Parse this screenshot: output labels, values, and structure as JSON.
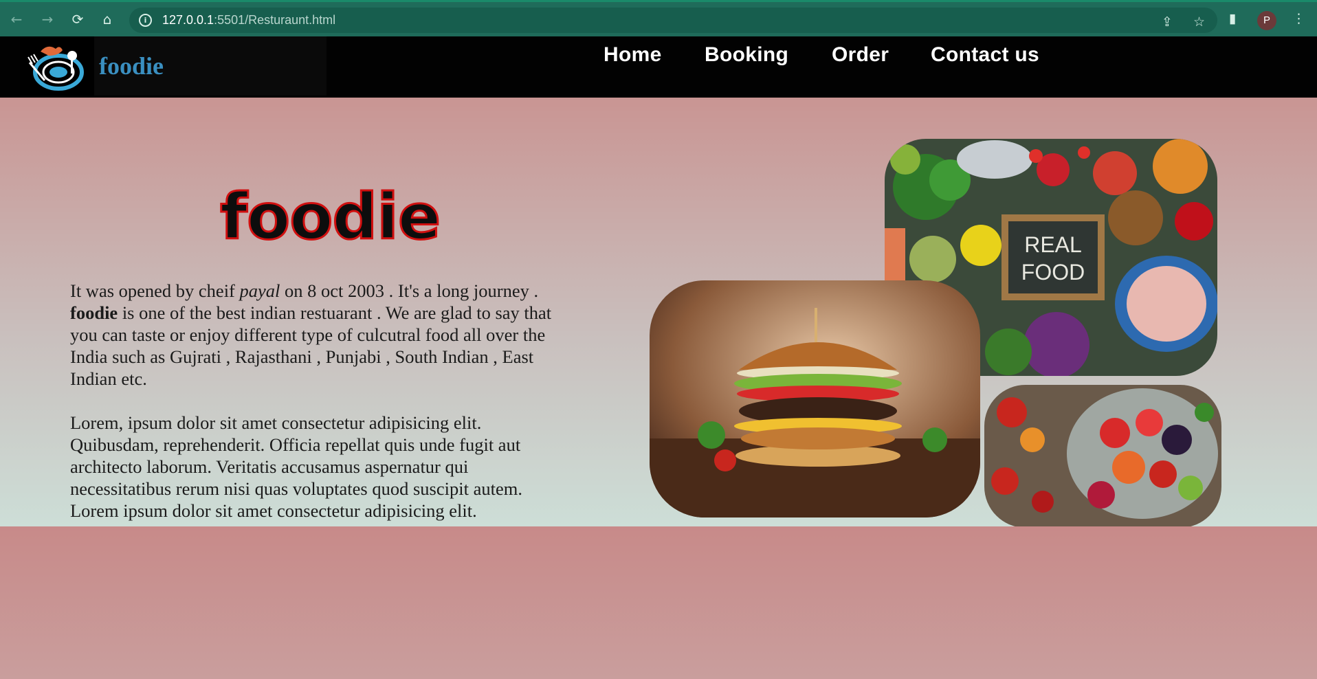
{
  "browser": {
    "url_host": "127.0.0.1",
    "url_path": ":5501/Resturaunt.html",
    "profile_initial": "P"
  },
  "site": {
    "logo_text": "foodie",
    "nav": [
      "Home",
      "Booking",
      "Order",
      "Contact us"
    ]
  },
  "hero": {
    "title": "foodie",
    "para1_a": "It was opened by cheif ",
    "para1_name": "payal",
    "para1_b": " on 8 oct 2003 . It's a long journey . ",
    "para1_brand": "foodie",
    "para1_c": " is one of the best indian restuarant . We are glad to say that you can taste or enjoy different type of culcutral food all over the India such as Gujrati , Rajasthani , Punjabi , South Indian , East Indian etc.",
    "para2": "Lorem, ipsum dolor sit amet consectetur adipisicing elit. Quibusdam, reprehenderit. Officia repellat quis unde fugit aut architecto laborum. Veritatis accusamus aspernatur qui necessitatibus rerum nisi quas voluptates quod suscipit autem. Lorem ipsum dolor sit amet consectetur adipisicing elit.",
    "food_sign_line1": "REAL",
    "food_sign_line2": "FOOD"
  },
  "icons": {
    "back": "back-arrow-icon",
    "forward": "forward-arrow-icon",
    "reload": "reload-icon",
    "home": "home-icon",
    "share": "share-icon",
    "bookmark": "star-icon",
    "sidepanel": "side-panel-icon",
    "menu": "kebab-menu-icon"
  },
  "colors": {
    "chrome": "#1f6b5a",
    "header": "#020202",
    "logo_text": "#3a8fc0",
    "title_stroke": "#d01010"
  }
}
